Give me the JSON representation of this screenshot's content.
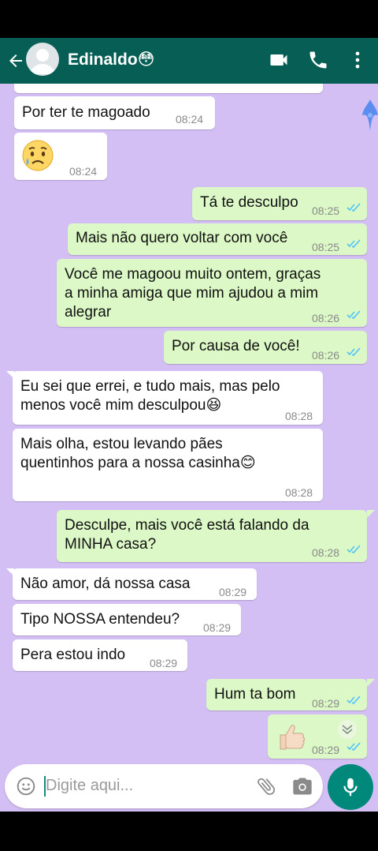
{
  "header": {
    "contact_name": "Edinaldo😳",
    "icons": [
      "back-arrow-icon",
      "avatar-icon",
      "video-call-icon",
      "phone-icon",
      "more-vert-icon"
    ]
  },
  "messages": [
    {
      "dir": "in",
      "text": "Por ter te magoado",
      "time": "08:24"
    },
    {
      "dir": "in",
      "text": "😥",
      "time": "08:24"
    },
    {
      "dir": "out",
      "text": "Tá te desculpo",
      "time": "08:25",
      "status": "read"
    },
    {
      "dir": "out",
      "text": "Mais não quero voltar com você",
      "time": "08:25",
      "status": "read"
    },
    {
      "dir": "out",
      "lines": [
        "Você me magoou muito ontem, graças",
        "a minha amiga que mim ajudou a mim",
        "alegrar"
      ],
      "time": "08:26",
      "status": "read"
    },
    {
      "dir": "out",
      "text": "Por causa de você!",
      "time": "08:26",
      "status": "read"
    },
    {
      "dir": "in",
      "lines": [
        "Eu sei que errei, e tudo mais,  mas pelo",
        "menos você mim desculpou😆"
      ],
      "time": "08:28"
    },
    {
      "dir": "in",
      "lines": [
        "Mais olha, estou levando pães",
        "quentinhos para a nossa casinha😊"
      ],
      "time": "08:28"
    },
    {
      "dir": "out",
      "lines": [
        "Desculpe, mais você está falando da",
        "MINHA casa?"
      ],
      "time": "08:28",
      "status": "read"
    },
    {
      "dir": "in",
      "text": "Não amor, dá nossa casa",
      "time": "08:29"
    },
    {
      "dir": "in",
      "text": "Tipo NOSSA entendeu?",
      "time": "08:29"
    },
    {
      "dir": "in",
      "text": "Pera estou indo",
      "time": "08:29"
    },
    {
      "dir": "out",
      "text": "Hum ta bom",
      "time": "08:29",
      "status": "read"
    },
    {
      "dir": "out",
      "text": "👍🏻",
      "time": "08:29",
      "status": "read"
    }
  ],
  "composer": {
    "placeholder": "Digite aqui...",
    "icons": [
      "emoji-icon",
      "attach-icon",
      "camera-icon",
      "mic-icon"
    ]
  },
  "colors": {
    "header": "#075e54",
    "chat_bg": "#d4bff5",
    "outgoing": "#dcf8c6",
    "incoming": "#ffffff",
    "read_ticks": "#4fc3f7",
    "mic_button": "#00897b"
  }
}
